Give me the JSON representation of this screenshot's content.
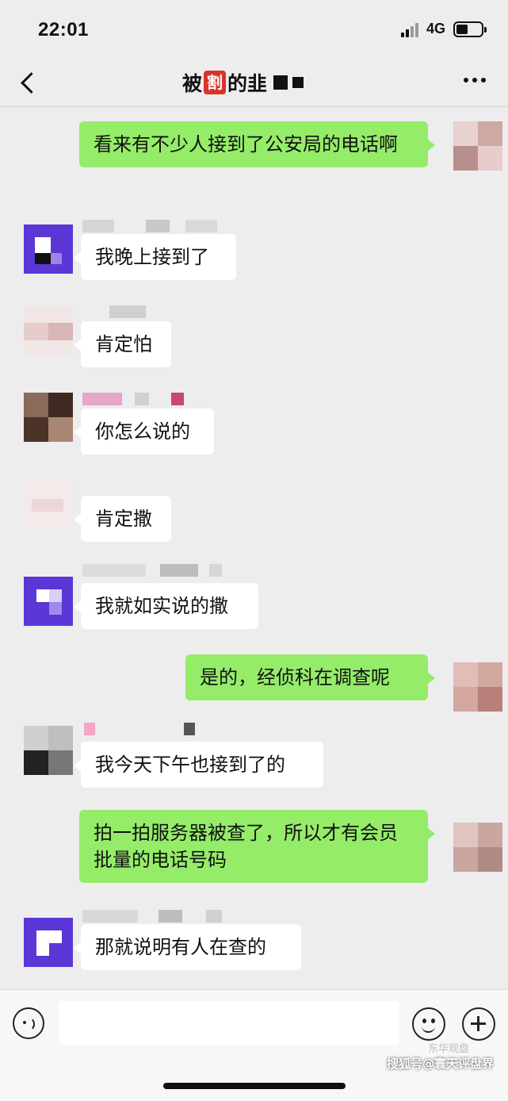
{
  "status_bar": {
    "time": "22:01",
    "network": "4G",
    "battery_level": 0.45
  },
  "header": {
    "title_prefix": "被",
    "title_seal": "割",
    "title_suffix": "的韭"
  },
  "messages": [
    {
      "side": "right",
      "text": "看来有不少人接到了公安局的电话啊"
    },
    {
      "side": "left",
      "text": "我晚上接到了"
    },
    {
      "side": "left",
      "text": "肯定怕"
    },
    {
      "side": "left",
      "text": "你怎么说的"
    },
    {
      "side": "left",
      "text": "肯定撒"
    },
    {
      "side": "left",
      "text": "我就如实说的撒"
    },
    {
      "side": "right",
      "text": "是的，经侦科在调查呢"
    },
    {
      "side": "left",
      "text": "我今天下午也接到了的"
    },
    {
      "side": "right",
      "text": "拍一拍服务器被查了，所以才有会员批量的电话号码"
    },
    {
      "side": "left",
      "text": "那就说明有人在查的"
    }
  ],
  "input_bar": {
    "placeholder": ""
  },
  "watermark": {
    "text": "搜狐号@寰天评盘界",
    "faint_text": "东华观盘"
  },
  "colors": {
    "background": "#ededed",
    "bubble_right": "#95ec69",
    "bubble_left": "#ffffff",
    "title_seal": "#d8342c"
  },
  "icons": [
    "back-arrow-icon",
    "more-dots-icon",
    "voice-icon",
    "emoji-icon",
    "plus-icon"
  ]
}
